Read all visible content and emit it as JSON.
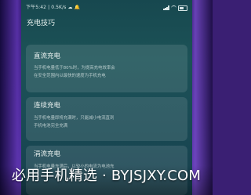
{
  "status_bar": {
    "time_info": "下午5:42 | 0.5K/s ☁ 🔔"
  },
  "page": {
    "title": "充电技巧"
  },
  "cards": [
    {
      "title": "直流充电",
      "body_lines": [
        "当手机电量低于80%时，为提高充电效率会",
        "在安全范围内以最快的速度为手机充电"
      ]
    },
    {
      "title": "连续充电",
      "body_lines": [
        "当手机电量即将充满时，只能减小电流直到",
        "手机电池完全充满"
      ]
    },
    {
      "title": "涓流充电",
      "body_lines": [
        "当手机电量充满后，以较小的电流为电池充"
      ]
    }
  ],
  "watermark": {
    "text": "必用手机精选 · BYJSJXY.COM"
  },
  "colors": {
    "phone_bg": "#1c5257",
    "card_bg": "rgba(255,255,255,0.11)",
    "frame_bg": "#3a1f73"
  }
}
